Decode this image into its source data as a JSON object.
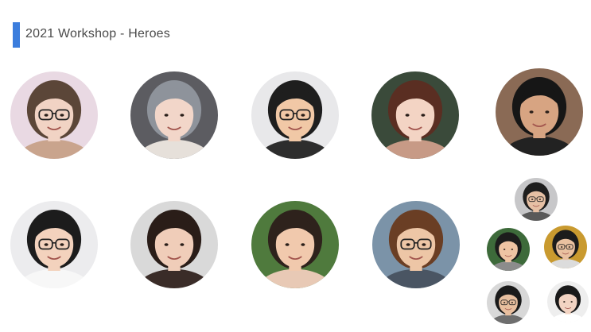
{
  "header": {
    "title": "2021 Workshop - Heroes",
    "accent_color": "#3b7ddd"
  },
  "people": [
    {
      "id": "hero-1",
      "bg": "#e9d9e3",
      "skin": "#f1d3c4",
      "hair": "#5b4638",
      "shirt": "#c9a48d",
      "glasses": true
    },
    {
      "id": "hero-2",
      "bg": "#5c5c61",
      "skin": "#f2d6c9",
      "hair": "#8e939b",
      "shirt": "#e6e0da",
      "glasses": false
    },
    {
      "id": "hero-3",
      "bg": "#e8e8ea",
      "skin": "#f1c8a6",
      "hair": "#1e1e1e",
      "shirt": "#2d2d2d",
      "glasses": true
    },
    {
      "id": "hero-4",
      "bg": "#3a4a3a",
      "skin": "#f3d4c4",
      "hair": "#5a2e22",
      "shirt": "#c79a86",
      "glasses": false
    },
    {
      "id": "hero-5",
      "bg": "#8a6a55",
      "skin": "#d7a482",
      "hair": "#161616",
      "shirt": "#222222",
      "glasses": false
    },
    {
      "id": "hero-6",
      "bg": "#ececee",
      "skin": "#f3d2bd",
      "hair": "#1c1c1c",
      "shirt": "#f7f7f7",
      "glasses": true
    },
    {
      "id": "hero-7",
      "bg": "#d9d9d9",
      "skin": "#f0cdb9",
      "hair": "#2a1d18",
      "shirt": "#3a2c28",
      "glasses": false
    },
    {
      "id": "hero-8",
      "bg": "#4f7a3d",
      "skin": "#f1c9ad",
      "hair": "#2e221c",
      "shirt": "#e8c9b5",
      "glasses": false
    },
    {
      "id": "hero-9",
      "bg": "#7b93a8",
      "skin": "#edc6a6",
      "hair": "#6a3e24",
      "shirt": "#4a5563",
      "glasses": true
    },
    {
      "id": "hero-10",
      "bg": "#c7c7c9",
      "skin": "#e6c0a4",
      "hair": "#1e1e1e",
      "shirt": "#595959",
      "glasses": true
    },
    {
      "id": "hero-11",
      "bg": "#3d6a3a",
      "skin": "#eec3a3",
      "hair": "#1c1c1c",
      "shirt": "#8c8c8c",
      "glasses": false
    },
    {
      "id": "hero-12",
      "bg": "#c99a2f",
      "skin": "#eac1a0",
      "hair": "#1c1c1c",
      "shirt": "#dcdcdc",
      "glasses": true
    },
    {
      "id": "hero-13",
      "bg": "#d8d8d8",
      "skin": "#e8bf9f",
      "hair": "#1a1a1a",
      "shirt": "#6e6e6e",
      "glasses": true
    },
    {
      "id": "hero-14",
      "bg": "#eeeeee",
      "skin": "#f3d4c3",
      "hair": "#1a1a1a",
      "shirt": "#ffffff",
      "glasses": false
    }
  ]
}
